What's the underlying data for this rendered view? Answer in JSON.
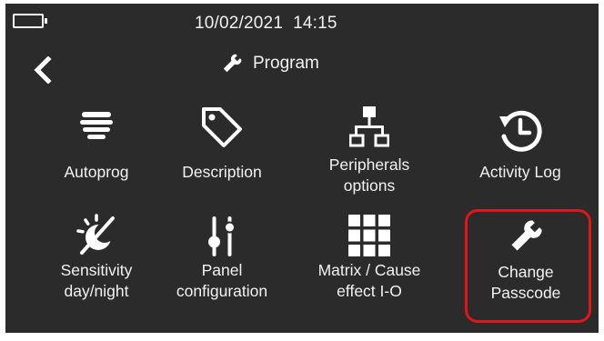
{
  "status_bar": {
    "date": "10/02/2021",
    "time": "14:15",
    "battery_icon": "battery-empty-icon"
  },
  "header": {
    "back_icon": "chevron-left-icon",
    "title_icon": "wrench-icon",
    "title": "Program"
  },
  "menu": {
    "autoprog": {
      "label": "Autoprog",
      "icon": "smoke-detector-icon"
    },
    "description": {
      "label": "Description",
      "icon": "tag-icon"
    },
    "peripherals": {
      "label_line1": "Peripherals",
      "label_line2": "options",
      "icon": "network-tree-icon"
    },
    "activity_log": {
      "label": "Activity Log",
      "icon": "history-clock-icon"
    },
    "sensitivity": {
      "label_line1": "Sensitivity",
      "label_line2": "day/night",
      "icon": "sun-moon-icon"
    },
    "panel_config": {
      "label_line1": "Panel",
      "label_line2": "configuration",
      "icon": "sliders-icon"
    },
    "matrix": {
      "label_line1": "Matrix / Cause",
      "label_line2": "effect I-O",
      "icon": "grid-icon"
    },
    "change_passcode": {
      "label_line1": "Change",
      "label_line2": "Passcode",
      "icon": "wrench-icon",
      "highlighted": true
    }
  },
  "colors": {
    "background": "#2b2b2b",
    "text": "#f2f2f2",
    "highlight": "#e0161b"
  }
}
